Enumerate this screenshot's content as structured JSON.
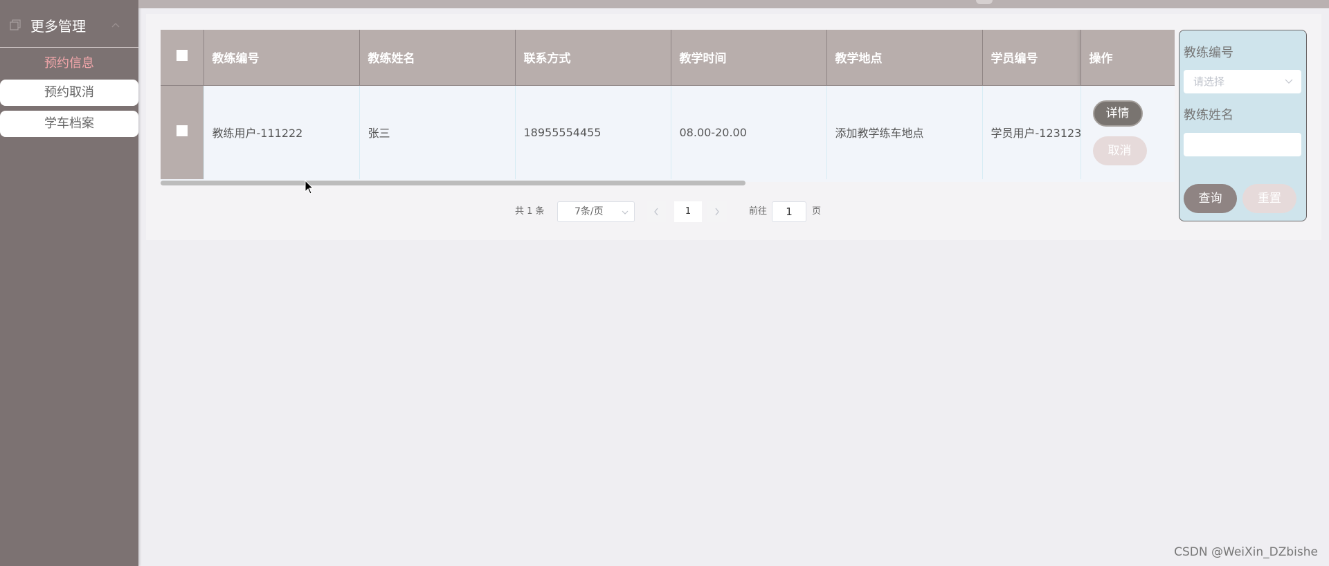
{
  "sidebar": {
    "menu_title": "更多管理",
    "items": [
      {
        "label": "预约信息",
        "active": true
      },
      {
        "label": "预约取消",
        "active": false
      },
      {
        "label": "学车档案",
        "active": false
      }
    ]
  },
  "table": {
    "columns": [
      "教练编号",
      "教练姓名",
      "联系方式",
      "教学时间",
      "教学地点",
      "学员编号",
      "操作"
    ],
    "rows": [
      {
        "coach_id": "教练用户-111222",
        "coach_name": "张三",
        "phone": "18955554455",
        "time": "08.00-20.00",
        "location": "添加教学练车地点",
        "student_id": "学员用户-123123",
        "actions": {
          "detail": "详情",
          "cancel": "取消"
        }
      }
    ]
  },
  "pagination": {
    "total_text": "共 1 条",
    "page_size": "7条/页",
    "current_page": "1",
    "goto_label": "前往",
    "goto_value": "1",
    "page_unit": "页",
    "prev_icon": "chevron-left-icon",
    "next_icon": "chevron-right-icon"
  },
  "search": {
    "coach_id_label": "教练编号",
    "coach_id_placeholder": "请选择",
    "coach_name_label": "教练姓名",
    "coach_name_value": "",
    "query_label": "查询",
    "reset_label": "重置"
  },
  "watermark": "CSDN @WeiXin_DZbishe",
  "colors": {
    "sidebar_bg": "#7c7272",
    "active_item": "#f2a6aa",
    "header_bg": "#b8aeac",
    "search_bg": "#cfe4ec",
    "detail_button": "#797470",
    "cancel_button": "#e6dada"
  }
}
